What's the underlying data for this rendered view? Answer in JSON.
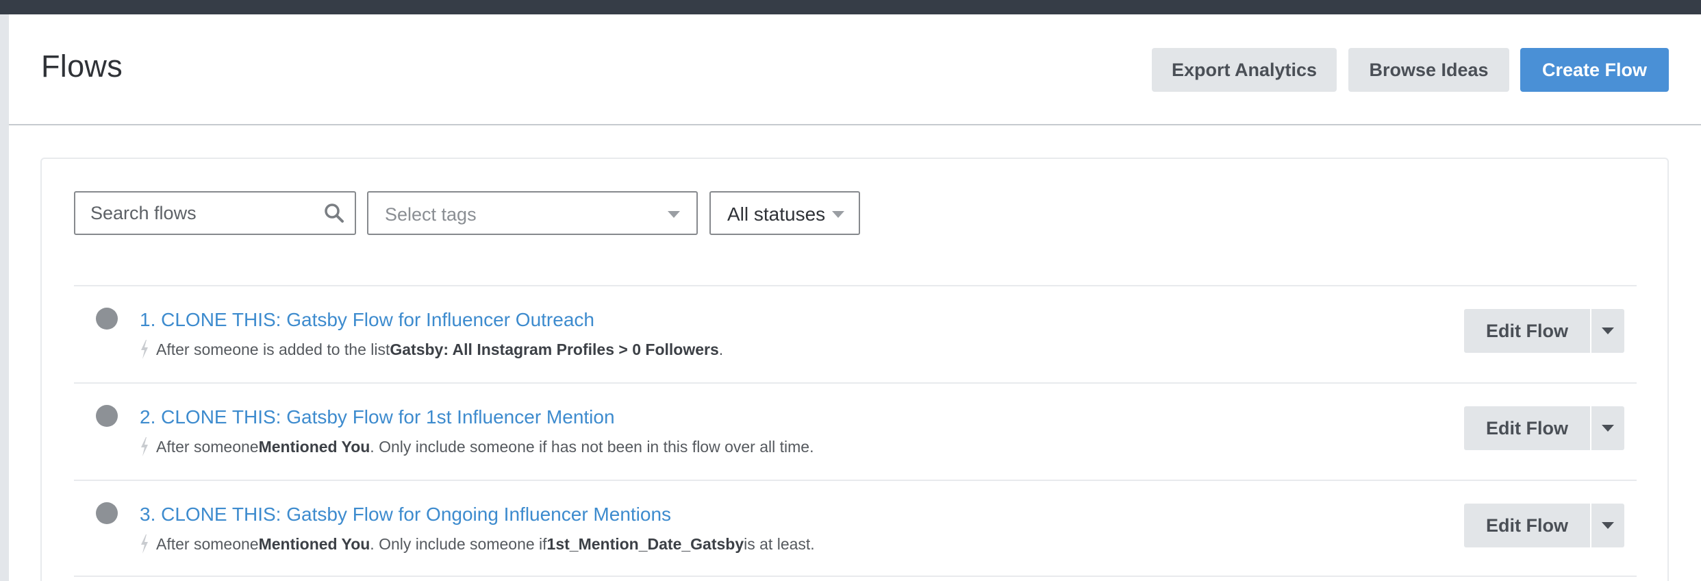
{
  "header": {
    "title": "Flows",
    "buttons": {
      "export": "Export Analytics",
      "browse": "Browse Ideas",
      "create": "Create Flow"
    }
  },
  "filters": {
    "search_placeholder": "Search flows",
    "tags_placeholder": "Select tags",
    "status_value": "All statuses"
  },
  "flows": [
    {
      "title": "1. CLONE THIS: Gatsby Flow for Influencer Outreach",
      "t1": "After someone is added to the list ",
      "b1": "Gatsby: All Instagram Profiles > 0 Followers",
      "t2": ".",
      "b2": "",
      "t3": "",
      "edit_label": "Edit Flow"
    },
    {
      "title": "2. CLONE THIS: Gatsby Flow for 1st Influencer Mention",
      "t1": "After someone ",
      "b1": "Mentioned You",
      "t2": ". Only include someone if has not been in this flow over all time.",
      "b2": "",
      "t3": "",
      "edit_label": "Edit Flow"
    },
    {
      "title": "3. CLONE THIS: Gatsby Flow for Ongoing Influencer Mentions",
      "t1": "After someone ",
      "b1": "Mentioned You",
      "t2": ". Only include someone if ",
      "b2": "1st_Mention_Date_Gatsby",
      "t3": " is at least.",
      "edit_label": "Edit Flow"
    }
  ],
  "colors": {
    "topbar": "#363d47",
    "primary": "#4a90d6",
    "link": "#3d8bce",
    "status_dot": "#8d9196"
  }
}
